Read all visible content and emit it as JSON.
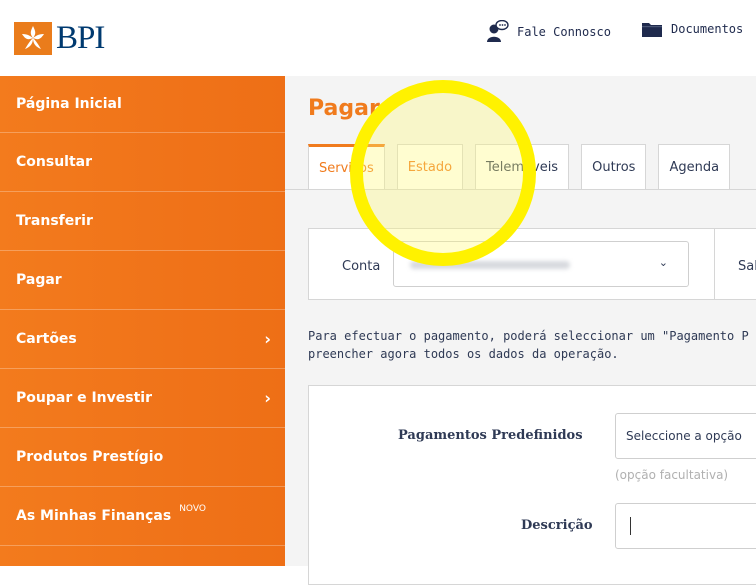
{
  "header": {
    "logo_text": "BPI",
    "links": [
      {
        "label": "Fale Connosco",
        "icon": "chat-person-icon"
      },
      {
        "label": "Documentos",
        "icon": "folder-icon"
      }
    ]
  },
  "sidebar": {
    "items": [
      {
        "label": "Página Inicial"
      },
      {
        "label": "Consultar"
      },
      {
        "label": "Transferir"
      },
      {
        "label": "Pagar"
      },
      {
        "label": "Cartões",
        "chevron": "›"
      },
      {
        "label": "Poupar e Investir",
        "chevron": "›"
      },
      {
        "label": "Produtos Prestígio"
      },
      {
        "label": "As Minhas Finanças",
        "badge": "NOVO"
      }
    ]
  },
  "main": {
    "title": "Pagar",
    "tabs": [
      {
        "label": "Serviços"
      },
      {
        "label": "Estado"
      },
      {
        "label": "Telemóveis"
      },
      {
        "label": "Outros"
      },
      {
        "label": "Agenda"
      }
    ],
    "conta": {
      "label": "Conta",
      "chevron": "⌄",
      "saldo_label": "Sal"
    },
    "info_line1": "Para efectuar o pagamento, poderá seleccionar um \"Pagamento P",
    "info_line2": "preencher agora todos os dados da operação.",
    "form": {
      "predef_label": "Pagamentos Predefinidos",
      "predef_placeholder": "Seleccione a opção",
      "predef_hint": "(opção facultativa)",
      "descricao_label": "Descrição",
      "descricao_value": ""
    }
  },
  "colors": {
    "brand_orange": "#f07b1d",
    "brand_navy": "#003a70",
    "highlight_yellow": "#fff200"
  }
}
